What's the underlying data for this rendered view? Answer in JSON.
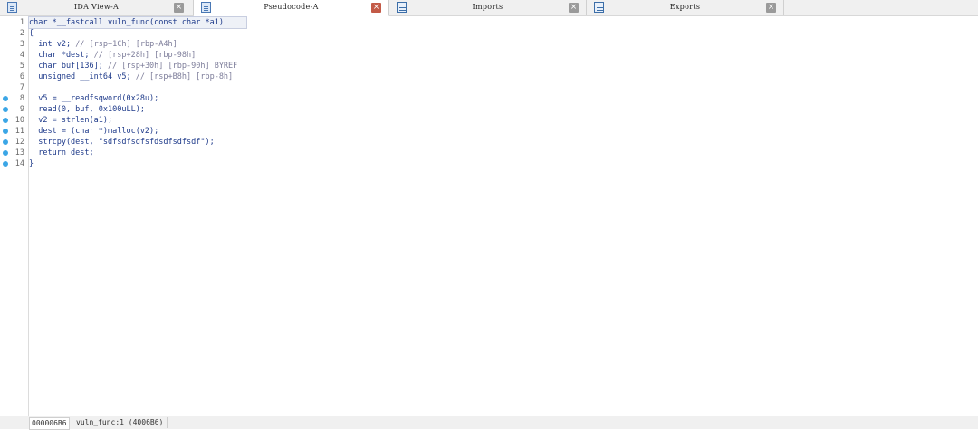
{
  "tabs": [
    {
      "label": "IDA View-A",
      "icon": "disassembly-view-icon",
      "active": false
    },
    {
      "label": "Pseudocode-A",
      "icon": "pseudocode-view-icon",
      "active": true
    },
    {
      "label": "Imports",
      "icon": "imports-icon",
      "active": false
    },
    {
      "label": "Exports",
      "icon": "exports-icon",
      "active": false
    }
  ],
  "gutter": {
    "line_numbers": [
      "1",
      "2",
      "3",
      "4",
      "5",
      "6",
      "7",
      "8",
      "9",
      "10",
      "11",
      "12",
      "13",
      "14"
    ],
    "breakpoint_lines": [
      "8",
      "9",
      "10",
      "11",
      "12",
      "13",
      "14"
    ],
    "dot_color": "#3ba6e6"
  },
  "code": {
    "lines": [
      {
        "code": "char *__fastcall vuln_func(const char *a1)",
        "comment": ""
      },
      {
        "code": "{",
        "comment": ""
      },
      {
        "code": "  int v2; ",
        "comment": "// [rsp+1Ch] [rbp-A4h]"
      },
      {
        "code": "  char *dest; ",
        "comment": "// [rsp+28h] [rbp-98h]"
      },
      {
        "code": "  char buf[136]; ",
        "comment": "// [rsp+30h] [rbp-90h] BYREF"
      },
      {
        "code": "  unsigned __int64 v5; ",
        "comment": "// [rsp+B8h] [rbp-8h]"
      },
      {
        "code": "",
        "comment": ""
      },
      {
        "code": "  v5 = __readfsqword(0x28u);",
        "comment": ""
      },
      {
        "code": "  read(0, buf, 0x100uLL);",
        "comment": ""
      },
      {
        "code": "  v2 = strlen(a1);",
        "comment": ""
      },
      {
        "code": "  dest = (char *)malloc(v2);",
        "comment": ""
      },
      {
        "code": "  strcpy(dest, \"sdfsdfsdfsfdsdfsdfsdf\");",
        "comment": ""
      },
      {
        "code": "  return dest;",
        "comment": ""
      },
      {
        "code": "}",
        "comment": ""
      }
    ]
  },
  "status": {
    "address": "000006B6",
    "location": "vuln_func:1 (4006B6)"
  }
}
